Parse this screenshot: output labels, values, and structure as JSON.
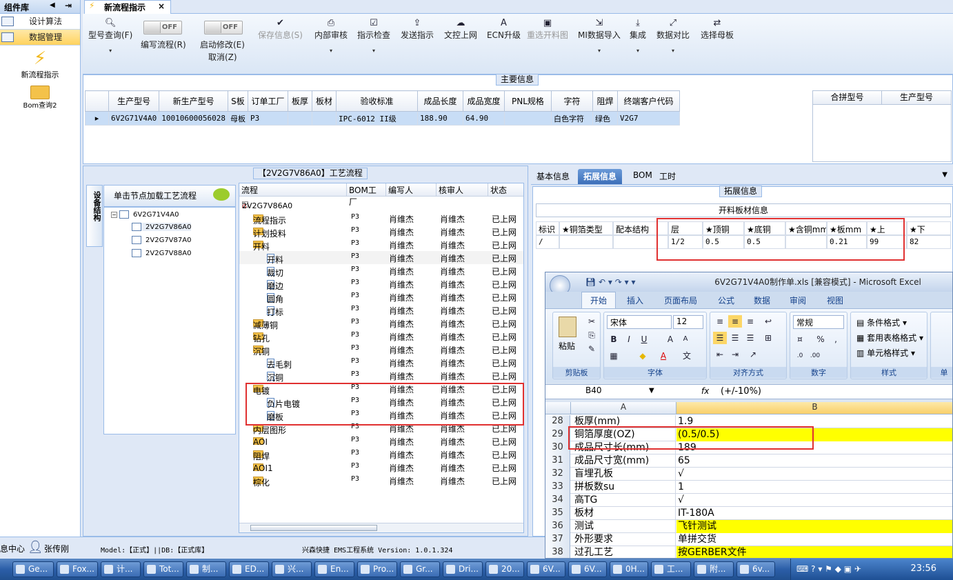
{
  "left_panel": {
    "header": "组件库",
    "items": [
      {
        "label": "设计算法"
      },
      {
        "label": "数据管理"
      }
    ],
    "big_items": [
      {
        "label": "新流程指示"
      },
      {
        "label": "Bom查询2"
      }
    ]
  },
  "doc_tab": {
    "title": "新流程指示",
    "close": "×"
  },
  "toolbar": {
    "model_query": "型号查询(F)",
    "edit_flow": "编写流程(R)",
    "edit_toggle": "OFF",
    "start_modify": "启动修改(E)",
    "start_toggle": "OFF",
    "cancel": "取消(Z)",
    "save": "保存信息(S)",
    "internal_review": "内部审核",
    "instruction_check": "指示检查",
    "send_instruction": "发送指示",
    "file_upload": "文控上网",
    "ecn_upgrade": "ECN升级",
    "reselect_cut": "重选开料图",
    "mi_import": "MI数据导入",
    "integrate": "集成",
    "data_compare": "数据对比",
    "select_mother": "选择母板"
  },
  "main_info": {
    "legend": "主要信息",
    "columns": [
      "生产型号",
      "新生产型号",
      "S板",
      "订单工厂",
      "板厚",
      "板材",
      "验收标准",
      "成品长度",
      "成品宽度",
      "PNL规格",
      "字符",
      "阻焊",
      "终端客户代码"
    ],
    "row": [
      "6V2G71V4A0",
      "10010600056028",
      "母板",
      "P3",
      "",
      "",
      "IPC-6012 II级",
      "188.90",
      "64.90",
      "",
      "白色字符",
      "绿色",
      "V2G7"
    ],
    "right_columns": [
      "合拼型号",
      "生产型号"
    ]
  },
  "process": {
    "legend": "【2V2G7V86A0】工艺流程",
    "side_tab": "设备结构",
    "node_header": "单击节点加载工艺流程",
    "tree": {
      "root": "6V2G71V4A0",
      "children": [
        "2V2G7V86A0",
        "2V2G7V87A0",
        "2V2G7V88A0"
      ]
    },
    "columns": [
      "流程",
      "BOM工厂",
      "编写人",
      "核审人",
      "状态"
    ],
    "root_node": "2V2G7V86A0",
    "rows": [
      {
        "name": "流程指示",
        "type": "folder",
        "level": 1,
        "factory": "P3",
        "writer": "肖维杰",
        "reviewer": "肖维杰",
        "status": "已上网"
      },
      {
        "name": "计划投料",
        "type": "folder",
        "level": 1,
        "factory": "P3",
        "writer": "肖维杰",
        "reviewer": "肖维杰",
        "status": "已上网"
      },
      {
        "name": "开料",
        "type": "folder",
        "level": 1,
        "factory": "P3",
        "writer": "肖维杰",
        "reviewer": "肖维杰",
        "status": "已上网"
      },
      {
        "name": "开料",
        "type": "doc",
        "level": 2,
        "factory": "P3",
        "writer": "肖维杰",
        "reviewer": "肖维杰",
        "status": "已上网"
      },
      {
        "name": "裁切",
        "type": "doc",
        "level": 2,
        "factory": "P3",
        "writer": "肖维杰",
        "reviewer": "肖维杰",
        "status": "已上网"
      },
      {
        "name": "磨边",
        "type": "doc",
        "level": 2,
        "factory": "P3",
        "writer": "肖维杰",
        "reviewer": "肖维杰",
        "status": "已上网"
      },
      {
        "name": "圆角",
        "type": "doc",
        "level": 2,
        "factory": "P3",
        "writer": "肖维杰",
        "reviewer": "肖维杰",
        "status": "已上网"
      },
      {
        "name": "打标",
        "type": "doc",
        "level": 2,
        "factory": "P3",
        "writer": "肖维杰",
        "reviewer": "肖维杰",
        "status": "已上网"
      },
      {
        "name": "减薄铜",
        "type": "folder",
        "level": 1,
        "factory": "P3",
        "writer": "肖维杰",
        "reviewer": "肖维杰",
        "status": "已上网"
      },
      {
        "name": "钻孔",
        "type": "folder",
        "level": 1,
        "factory": "P3",
        "writer": "肖维杰",
        "reviewer": "肖维杰",
        "status": "已上网"
      },
      {
        "name": "沉铜",
        "type": "folder",
        "level": 1,
        "factory": "P3",
        "writer": "肖维杰",
        "reviewer": "肖维杰",
        "status": "已上网"
      },
      {
        "name": "去毛刺",
        "type": "doc",
        "level": 2,
        "factory": "P3",
        "writer": "肖维杰",
        "reviewer": "肖维杰",
        "status": "已上网"
      },
      {
        "name": "沉铜",
        "type": "doc",
        "level": 2,
        "factory": "P3",
        "writer": "肖维杰",
        "reviewer": "肖维杰",
        "status": "已上网"
      },
      {
        "name": "电镀",
        "type": "folder",
        "level": 1,
        "factory": "P3",
        "writer": "肖维杰",
        "reviewer": "肖维杰",
        "status": "已上网"
      },
      {
        "name": "负片电镀",
        "type": "doc",
        "level": 2,
        "factory": "P3",
        "writer": "肖维杰",
        "reviewer": "肖维杰",
        "status": "已上网"
      },
      {
        "name": "磨板",
        "type": "doc",
        "level": 2,
        "factory": "P3",
        "writer": "肖维杰",
        "reviewer": "肖维杰",
        "status": "已上网"
      },
      {
        "name": "内层图形",
        "type": "folder",
        "level": 1,
        "factory": "P3",
        "writer": "肖维杰",
        "reviewer": "肖维杰",
        "status": "已上网"
      },
      {
        "name": "AOI",
        "type": "folder",
        "level": 1,
        "factory": "P3",
        "writer": "肖维杰",
        "reviewer": "肖维杰",
        "status": "已上网"
      },
      {
        "name": "阻焊",
        "type": "folder",
        "level": 1,
        "factory": "P3",
        "writer": "肖维杰",
        "reviewer": "肖维杰",
        "status": "已上网"
      },
      {
        "name": "AOI1",
        "type": "folder",
        "level": 1,
        "factory": "P3",
        "writer": "肖维杰",
        "reviewer": "肖维杰",
        "status": "已上网"
      },
      {
        "name": "棕化",
        "type": "folder",
        "level": 1,
        "factory": "P3",
        "writer": "肖维杰",
        "reviewer": "肖维杰",
        "status": "已上网"
      }
    ]
  },
  "right_panel": {
    "tabs": [
      "基本信息",
      "拓展信息",
      "BOM",
      "工时"
    ],
    "active_tab": "拓展信息",
    "legend": "拓展信息",
    "table_title": "开料板材信息",
    "columns": [
      "标识",
      "★铜箔类型",
      "配本结构",
      "层",
      "★顶铜",
      "★底铜",
      "★含铜mm",
      "★板mm",
      "★上",
      "★下"
    ],
    "row": [
      "/",
      "",
      "",
      "1/2",
      "0.5",
      "0.5",
      "",
      "0.21",
      "99",
      "82"
    ]
  },
  "excel": {
    "title": "6V2G71V4A0制作单.xls  [兼容模式] - Microsoft Excel",
    "tabs": [
      "开始",
      "插入",
      "页面布局",
      "公式",
      "数据",
      "审阅",
      "视图"
    ],
    "font_name": "宋体",
    "font_size": "12",
    "number_format": "常规",
    "groups": [
      "剪贴板",
      "字体",
      "对齐方式",
      "数字",
      "样式",
      "单"
    ],
    "paste": "粘贴",
    "styles": [
      "条件格式",
      "套用表格格式",
      "单元格样式"
    ],
    "name_box": "B40",
    "formula": "(+/-10%)",
    "fx": "fx",
    "col_a": "A",
    "col_b": "B",
    "rows": [
      {
        "n": "28",
        "a": "板厚(mm)",
        "b": "1.9",
        "y": false
      },
      {
        "n": "29",
        "a": "铜箔厚度(OZ)",
        "b": "(0.5/0.5)",
        "y": true
      },
      {
        "n": "30",
        "a": "成品尺寸长(mm)",
        "b": "189",
        "y": false
      },
      {
        "n": "31",
        "a": "成品尺寸宽(mm)",
        "b": "65",
        "y": false
      },
      {
        "n": "32",
        "a": "盲埋孔板",
        "b": "√",
        "y": false
      },
      {
        "n": "33",
        "a": "拼板数su",
        "b": "1",
        "y": false
      },
      {
        "n": "34",
        "a": "高TG",
        "b": "√",
        "y": false
      },
      {
        "n": "35",
        "a": "板材",
        "b": "IT-180A",
        "y": false
      },
      {
        "n": "36",
        "a": "测试",
        "b": "飞针测试",
        "y": true
      },
      {
        "n": "37",
        "a": "外形要求",
        "b": "单拼交货",
        "y": false
      },
      {
        "n": "38",
        "a": "过孔工艺",
        "b": "按GERBER文件",
        "y": true
      }
    ]
  },
  "status_bar": {
    "left": "息中心",
    "user": "张传刚",
    "model": "Model:【正式】||DB:【正式库】",
    "system": "兴森快捷 EMS工程系统 Version: 1.0.1.324"
  },
  "taskbar": {
    "items": [
      "Ge...",
      "Fox...",
      "计...",
      "Tot...",
      "制...",
      "ED...",
      "兴...",
      "En...",
      "Pro...",
      "Gr...",
      "Dri...",
      "20...",
      "6V...",
      "6V...",
      "0H...",
      "工...",
      "附...",
      "6v..."
    ],
    "clock": "23:56"
  }
}
